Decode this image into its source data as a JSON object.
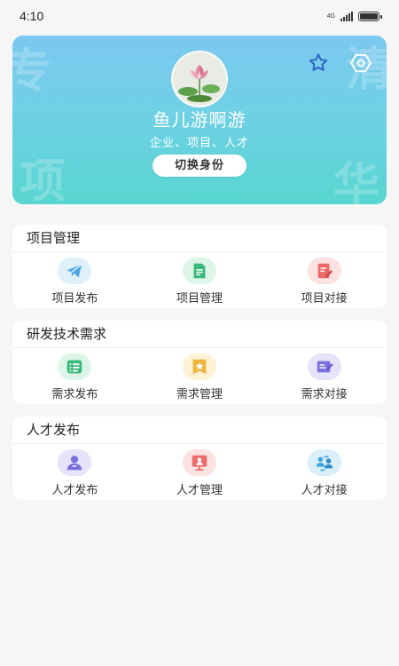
{
  "status_bar": {
    "time": "4:10",
    "network": "4G"
  },
  "profile": {
    "name": "鱼儿游啊游",
    "tags": "企业、项目、人才",
    "switch_label": "切换身份",
    "watermarks": [
      "专",
      "项",
      "清",
      "华"
    ]
  },
  "sections": [
    {
      "title": "项目管理",
      "items": [
        {
          "label": "项目发布",
          "icon": "paper-plane-icon",
          "color": "#4aa8e8",
          "bg": "#dff0fb"
        },
        {
          "label": "项目管理",
          "icon": "document-list-icon",
          "color": "#39b87a",
          "bg": "#dcf5e8"
        },
        {
          "label": "项目对接",
          "icon": "edit-document-icon",
          "color": "#ee6a6a",
          "bg": "#fde2e2"
        }
      ]
    },
    {
      "title": "研发技术需求",
      "items": [
        {
          "label": "需求发布",
          "icon": "list-icon",
          "color": "#39b87a",
          "bg": "#dcf5e8"
        },
        {
          "label": "需求管理",
          "icon": "star-card-icon",
          "color": "#f0b43c",
          "bg": "#fdf1d6"
        },
        {
          "label": "需求对接",
          "icon": "edit-card-icon",
          "color": "#7b6ee0",
          "bg": "#e7e3fa"
        }
      ]
    },
    {
      "title": "人才发布",
      "items": [
        {
          "label": "人才发布",
          "icon": "user-icon",
          "color": "#7b6ee0",
          "bg": "#e7e3fa"
        },
        {
          "label": "人才管理",
          "icon": "monitor-user-icon",
          "color": "#ee6a6a",
          "bg": "#fde2e2"
        },
        {
          "label": "人才对接",
          "icon": "people-exchange-icon",
          "color": "#3aa7e0",
          "bg": "#dbeffb"
        }
      ]
    }
  ]
}
